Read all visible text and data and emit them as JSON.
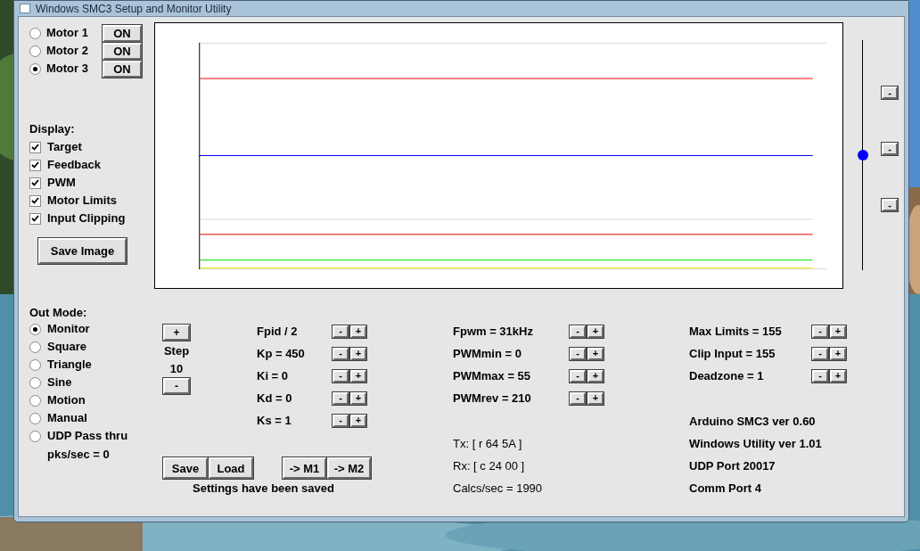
{
  "window": {
    "title": "Windows SMC3 Setup and Monitor Utility"
  },
  "motors": [
    {
      "label": "Motor 1",
      "selected": false,
      "button": "ON"
    },
    {
      "label": "Motor 2",
      "selected": false,
      "button": "ON"
    },
    {
      "label": "Motor 3",
      "selected": true,
      "button": "ON"
    }
  ],
  "display": {
    "label": "Display:",
    "options": [
      {
        "label": "Target",
        "checked": true
      },
      {
        "label": "Feedback",
        "checked": true
      },
      {
        "label": "PWM",
        "checked": true
      },
      {
        "label": "Motor Limits",
        "checked": true
      },
      {
        "label": "Input Clipping",
        "checked": true
      }
    ]
  },
  "save_image_button": "Save Image",
  "slider": {
    "level": 0.5
  },
  "slider_buttons": [
    "-",
    "-",
    "-"
  ],
  "out_mode": {
    "label": "Out Mode:",
    "options": [
      {
        "label": "Monitor",
        "selected": true
      },
      {
        "label": "Square",
        "selected": false
      },
      {
        "label": "Triangle",
        "selected": false
      },
      {
        "label": "Sine",
        "selected": false
      },
      {
        "label": "Motion",
        "selected": false
      },
      {
        "label": "Manual",
        "selected": false
      },
      {
        "label": "UDP Pass thru",
        "selected": false
      }
    ],
    "packets": "pks/sec = 0"
  },
  "step": {
    "plus": "+",
    "label": "Step",
    "value": "10",
    "minus": "-"
  },
  "pid_params": [
    {
      "label": "Fpid / 2",
      "minus": "-",
      "plus": "+"
    },
    {
      "label": "Kp = 450",
      "minus": "-",
      "plus": "+"
    },
    {
      "label": "Ki = 0",
      "minus": "-",
      "plus": "+"
    },
    {
      "label": "Kd = 0",
      "minus": "-",
      "plus": "+"
    },
    {
      "label": "Ks = 1",
      "minus": "-",
      "plus": "+"
    }
  ],
  "pwm_params": [
    {
      "label": "Fpwm = 31kHz",
      "minus": "-",
      "plus": "+"
    },
    {
      "label": "PWMmin = 0",
      "minus": "-",
      "plus": "+"
    },
    {
      "label": "PWMmax = 55",
      "minus": "-",
      "plus": "+"
    },
    {
      "label": "PWMrev = 210",
      "minus": "-",
      "plus": "+"
    }
  ],
  "limit_params": [
    {
      "label": "Max Limits = 155",
      "minus": "-",
      "plus": "+"
    },
    {
      "label": "Clip Input = 155",
      "minus": "-",
      "plus": "+"
    },
    {
      "label": "Deadzone = 1",
      "minus": "-",
      "plus": "+"
    }
  ],
  "settings_buttons": [
    "Save",
    "Load"
  ],
  "copy_buttons": [
    "-> M1",
    "-> M2"
  ],
  "status": "Settings have been saved",
  "comm": [
    "Tx: [ r 64 5A ]",
    "Rx: [ c 24 00 ]",
    "Calcs/sec = 1990"
  ],
  "info": [
    "Arduino SMC3 ver 0.60",
    "Windows Utility ver 1.01",
    "UDP Port 20017",
    "Comm Port 4"
  ]
}
